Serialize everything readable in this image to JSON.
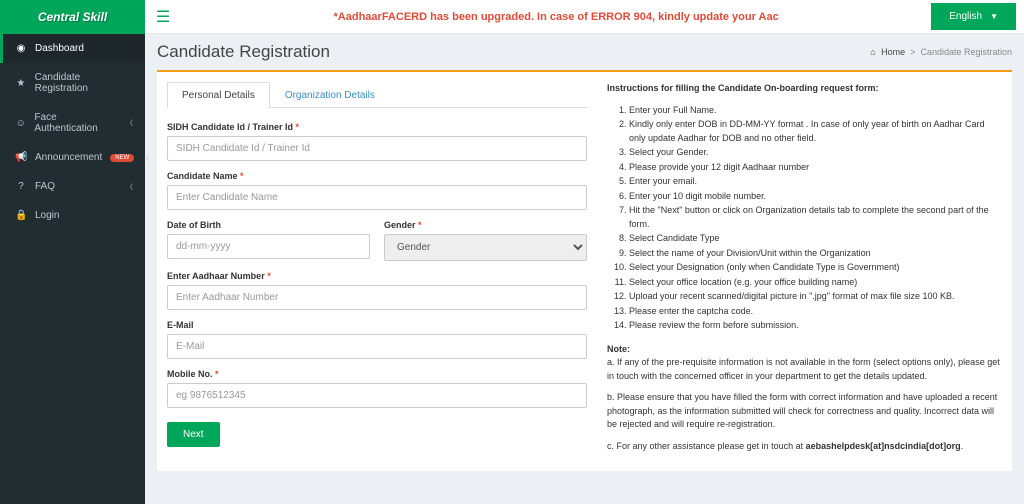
{
  "brand": "Central Skill",
  "marquee": "*AadhaarFACERD has been upgraded. In case of ERROR 904, kindly update your Aac",
  "lang": "English",
  "sidebar": {
    "items": [
      {
        "icon": "◉",
        "label": "Dashboard",
        "active": true,
        "arrow": false
      },
      {
        "icon": "★",
        "label": "Candidate Registration",
        "active": false,
        "arrow": false
      },
      {
        "icon": "☺",
        "label": "Face Authentication",
        "active": false,
        "arrow": true
      },
      {
        "icon": "📢",
        "label": "Announcement",
        "active": false,
        "arrow": true,
        "badge": "NEW"
      },
      {
        "icon": "?",
        "label": "FAQ",
        "active": false,
        "arrow": true
      },
      {
        "icon": "🔒",
        "label": "Login",
        "active": false,
        "arrow": false
      }
    ]
  },
  "page": {
    "title": "Candidate Registration",
    "breadcrumb_home": "Home",
    "breadcrumb_current": "Candidate Registration"
  },
  "tabs": {
    "personal": "Personal Details",
    "org": "Organization Details"
  },
  "form": {
    "sidh_label": "SIDH Candidate Id / Trainer Id",
    "sidh_ph": "SIDH Candidate Id / Trainer Id",
    "name_label": "Candidate Name",
    "name_ph": "Enter Candidate Name",
    "dob_label": "Date of Birth",
    "dob_ph": "dd-mm-yyyy",
    "gender_label": "Gender",
    "gender_opt": "Gender",
    "aadhaar_label": "Enter Aadhaar Number",
    "aadhaar_ph": "Enter Aadhaar Number",
    "email_label": "E-Mail",
    "email_ph": "E-Mail",
    "mobile_label": "Mobile No.",
    "mobile_ph": "eg 9876512345",
    "next": "Next"
  },
  "instr": {
    "heading": "Instructions for filling the Candidate On-boarding request form:",
    "items": [
      "Enter your Full Name.",
      "Kindly only enter DOB in DD-MM-YY format . In case of only year of birth on Aadhar Card only update Aadhar for DOB and no other field.",
      "Select your Gender.",
      "Please provide your 12 digit Aadhaar number",
      "Enter your email.",
      "Enter your 10 digit mobile number.",
      "Hit the \"Next\" button or click on Organization details tab to complete the second part of the form.",
      "Select Candidate Type",
      "Select the name of your Division/Unit within the Organization",
      "Select your Designation (only when Candidate Type is Government)",
      "Select your office location (e.g. your office building name)",
      "Upload your recent scanned/digital picture in \".jpg\" format of max file size 100 KB.",
      "Please enter the captcha code.",
      "Please review the form before submission."
    ],
    "note_label": "Note:",
    "note_a": "a. If any of the pre-requisite information is not available in the form (select options only), please get in touch with the concerned officer in your department to get the details updated.",
    "note_b": "b. Please ensure that you have filled the form with correct information and have uploaded a recent photograph, as the information submitted will check for correctness and quality. Incorrect data will be rejected and will require re-registration.",
    "note_c_pre": "c. For any other assistance please get in touch at ",
    "note_c_email": "aebashelpdesk[at]nsdcindia[dot]org",
    "note_c_post": "."
  }
}
